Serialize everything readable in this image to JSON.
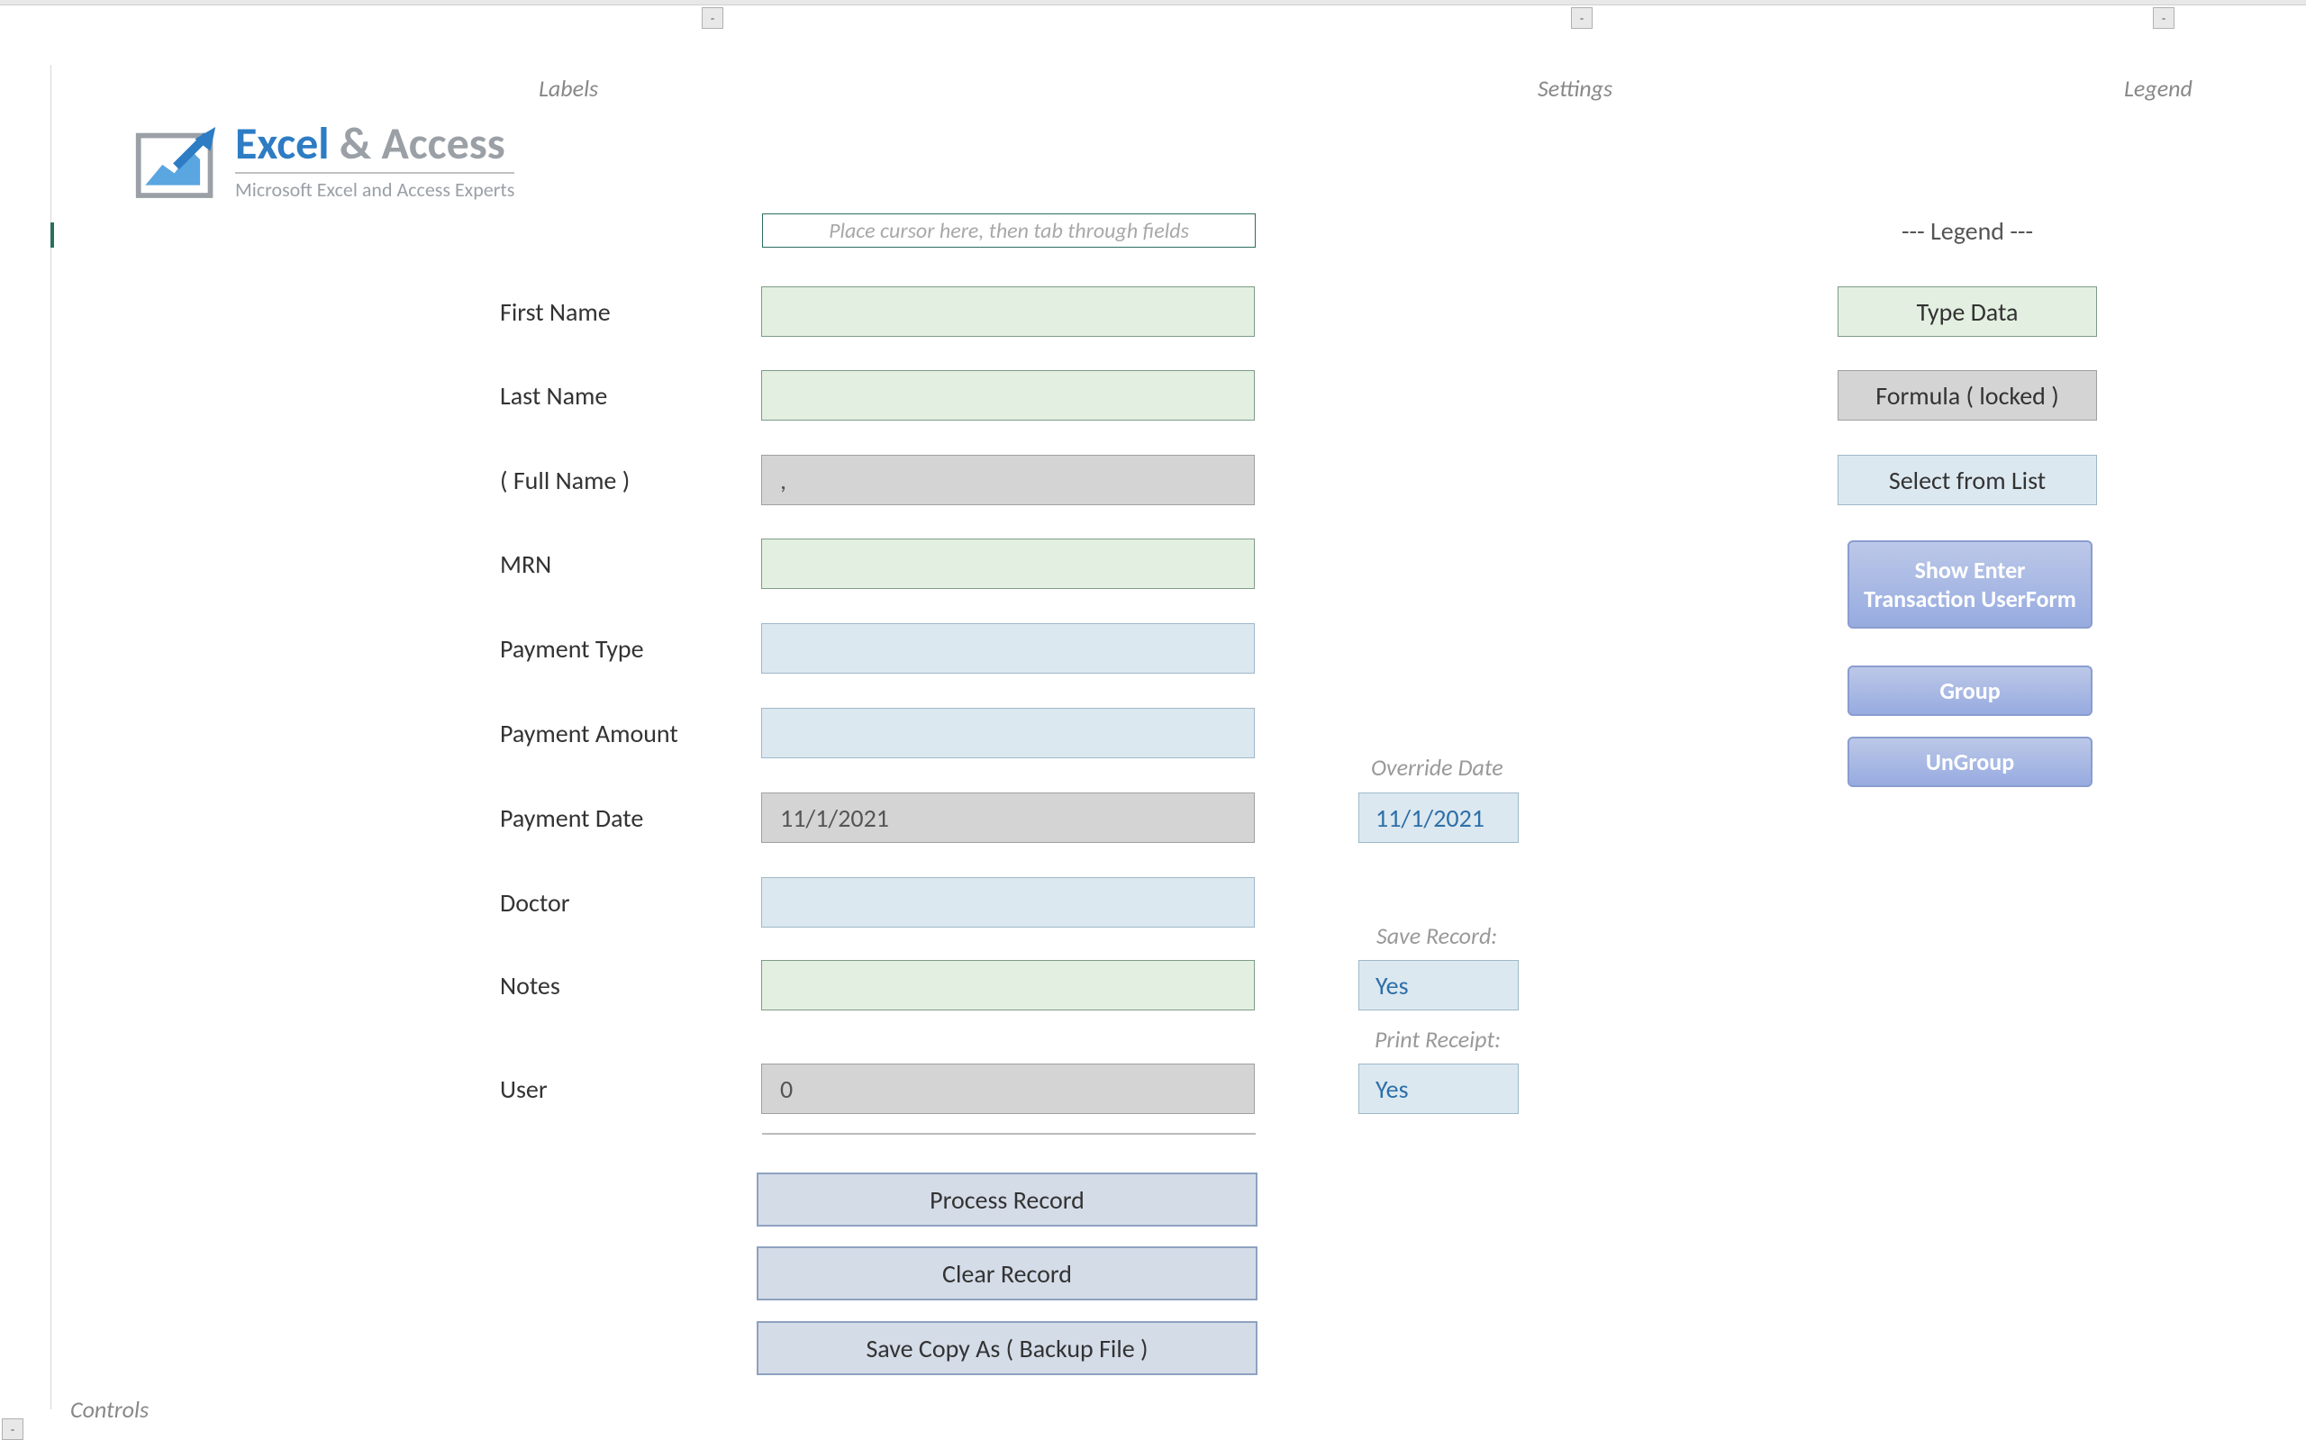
{
  "sections": {
    "labels": "Labels",
    "settings": "Settings",
    "legend": "Legend",
    "controls": "Controls"
  },
  "logo": {
    "brand_primary": "Excel",
    "brand_amp": "&",
    "brand_secondary": "Access",
    "tagline": "Microsoft Excel and Access Experts"
  },
  "hint": "Place cursor here, then tab through fields",
  "fields": {
    "first_name": {
      "label": "First Name",
      "value": ""
    },
    "last_name": {
      "label": "Last Name",
      "value": ""
    },
    "full_name": {
      "label": "( Full Name )",
      "value": ","
    },
    "mrn": {
      "label": "MRN",
      "value": ""
    },
    "payment_type": {
      "label": "Payment Type",
      "value": ""
    },
    "payment_amount": {
      "label": "Payment Amount",
      "value": ""
    },
    "payment_date": {
      "label": "Payment Date",
      "value": "11/1/2021"
    },
    "doctor": {
      "label": "Doctor",
      "value": ""
    },
    "notes": {
      "label": "Notes",
      "value": ""
    },
    "user": {
      "label": "User",
      "value": "0"
    }
  },
  "aux": {
    "override_date": {
      "label": "Override Date",
      "value": "11/1/2021"
    },
    "save_record": {
      "label": "Save Record:",
      "value": "Yes"
    },
    "print_receipt": {
      "label": "Print Receipt:",
      "value": "Yes"
    }
  },
  "buttons": {
    "process": "Process Record",
    "clear": "Clear Record",
    "backup": "Save Copy As ( Backup File )"
  },
  "legend": {
    "header": "---   Legend   ---",
    "type_data": "Type Data",
    "formula": "Formula ( locked )",
    "select": "Select from List"
  },
  "side_buttons": {
    "userform": "Show Enter Transaction UserForm",
    "group": "Group",
    "ungroup": "UnGroup"
  },
  "outline_toggle": "-"
}
